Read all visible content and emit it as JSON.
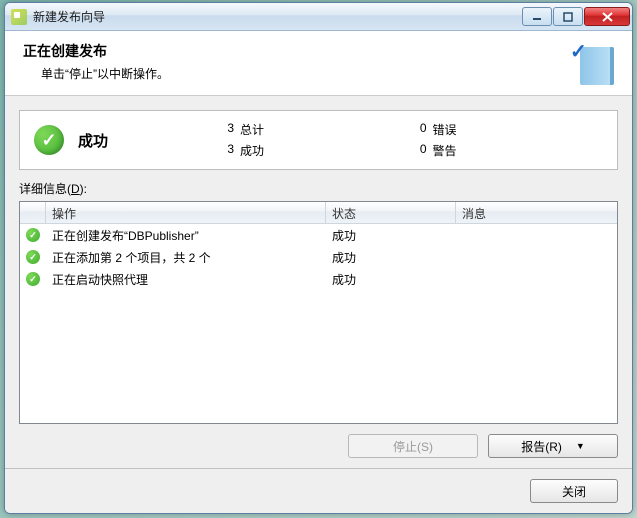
{
  "window": {
    "title": "新建发布向导"
  },
  "header": {
    "heading": "正在创建发布",
    "subheading": "单击“停止”以中断操作。"
  },
  "summary": {
    "status_label": "成功",
    "left": [
      {
        "count": "3",
        "label": "总计"
      },
      {
        "count": "3",
        "label": "成功"
      }
    ],
    "right": [
      {
        "count": "0",
        "label": "错误"
      },
      {
        "count": "0",
        "label": "警告"
      }
    ]
  },
  "details": {
    "label_prefix": "详细信息(",
    "label_key": "D",
    "label_suffix": "):",
    "columns": {
      "op": "操作",
      "status": "状态",
      "msg": "消息"
    },
    "rows": [
      {
        "op": "正在创建发布“DBPublisher”",
        "status": "成功",
        "msg": ""
      },
      {
        "op": "正在添加第 2 个项目，共 2 个",
        "status": "成功",
        "msg": ""
      },
      {
        "op": "正在启动快照代理",
        "status": "成功",
        "msg": ""
      }
    ]
  },
  "buttons": {
    "stop": "停止(S)",
    "report": "报告(R)",
    "close": "关闭"
  }
}
